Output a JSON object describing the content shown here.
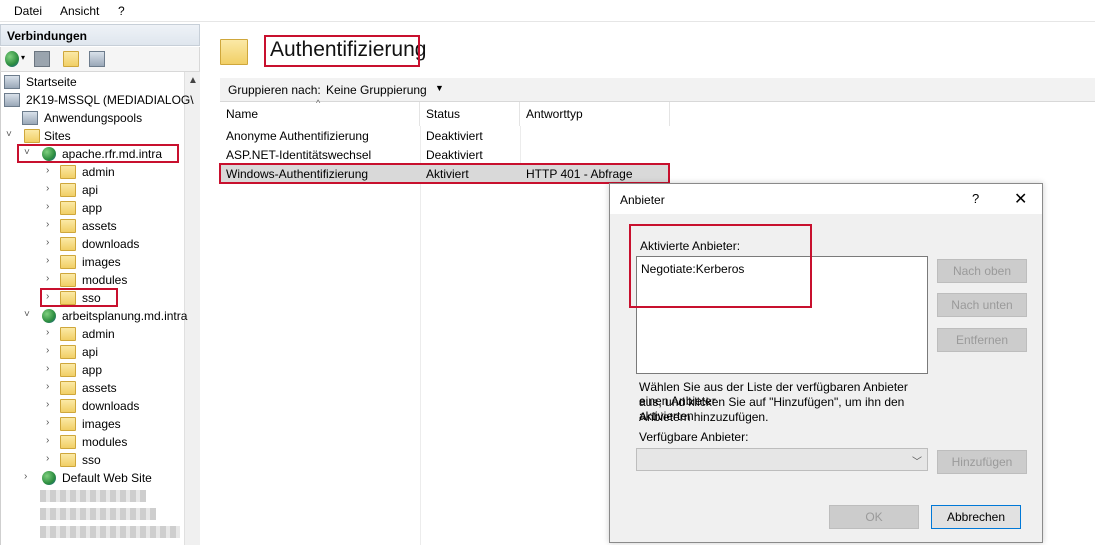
{
  "menu": {
    "file": "Datei",
    "view": "Ansicht",
    "help": "?"
  },
  "connections": {
    "header": "Verbindungen",
    "tree": {
      "start": "Startseite",
      "server": "2K19-MSSQL (MEDIADIALOG\\",
      "apppools": "Anwendungspools",
      "sites": "Sites",
      "site1": "apache.rfr.md.intra",
      "site1_children": [
        "admin",
        "api",
        "app",
        "assets",
        "downloads",
        "images",
        "modules",
        "sso"
      ],
      "site2": "arbeitsplanung.md.intra",
      "site2_children": [
        "admin",
        "api",
        "app",
        "assets",
        "downloads",
        "images",
        "modules",
        "sso"
      ],
      "site3": "Default Web Site"
    }
  },
  "main": {
    "title": "Authentifizierung",
    "group_label": "Gruppieren nach:",
    "group_value": "Keine Gruppierung",
    "columns": [
      "Name",
      "Status",
      "Antworttyp"
    ],
    "rows": [
      {
        "name": "Anonyme Authentifizierung",
        "status": "Deaktiviert",
        "response": ""
      },
      {
        "name": "ASP.NET-Identitätswechsel",
        "status": "Deaktiviert",
        "response": ""
      },
      {
        "name": "Windows-Authentifizierung",
        "status": "Aktiviert",
        "response": "HTTP 401 - Abfrage"
      }
    ]
  },
  "dialog": {
    "title": "Anbieter",
    "help": "?",
    "close": "✕",
    "enabled_label": "Aktivierte Anbieter:",
    "enabled_items": [
      "Negotiate:Kerberos"
    ],
    "btn_up": "Nach oben",
    "btn_down": "Nach unten",
    "btn_remove": "Entfernen",
    "info_lines": [
      "Wählen Sie aus der Liste der verfügbaren Anbieter einen Anbieter",
      "aus, und klicken Sie auf \"Hinzufügen\", um ihn den aktivierten",
      "Anbietern hinzuzufügen."
    ],
    "available_label": "Verfügbare Anbieter:",
    "btn_add": "Hinzufügen",
    "btn_ok": "OK",
    "btn_cancel": "Abbrechen"
  },
  "colors": {
    "highlight": "#c8102e",
    "selected_row": "#d9d9d9"
  }
}
